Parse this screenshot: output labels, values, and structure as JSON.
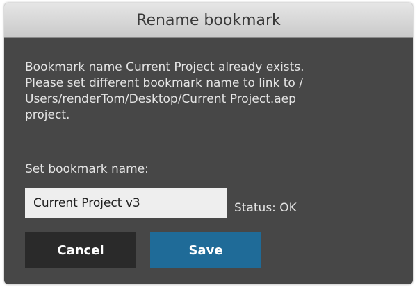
{
  "dialog": {
    "title": "Rename bookmark",
    "message_lines": [
      "Bookmark name Current Project already exists.",
      "Please set different bookmark name to link to /",
      "Users/renderTom/Desktop/Current Project.aep",
      "project."
    ],
    "field_label": "Set bookmark name:",
    "name_value": "Current Project v3",
    "status": "Status: OK",
    "cancel_label": "Cancel",
    "save_label": "Save"
  },
  "colors": {
    "background": "#474747",
    "titlebar": "#d6d6d6",
    "save_button": "#1f6b98",
    "cancel_button": "#2a2a2a",
    "input_background": "#eeeeee"
  }
}
